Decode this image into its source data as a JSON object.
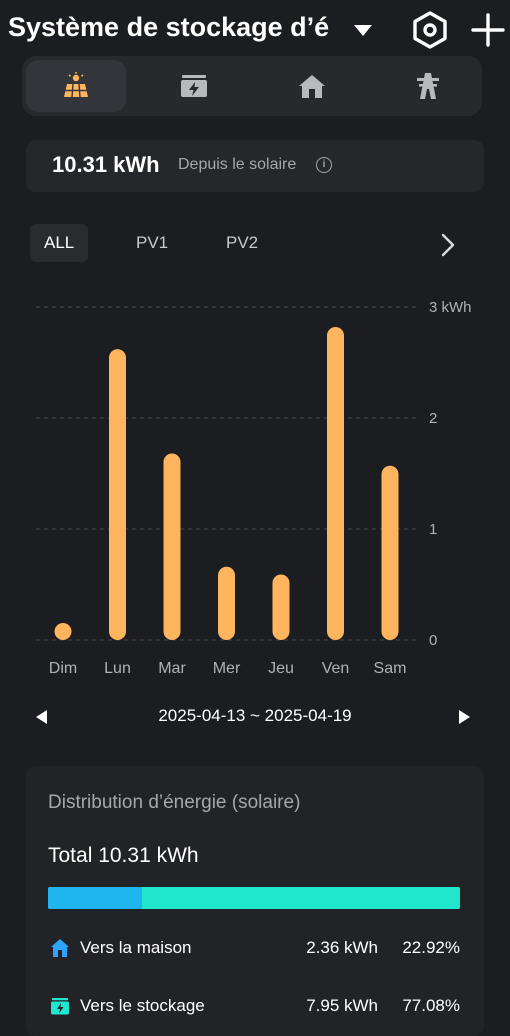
{
  "header": {
    "title": "Système de stockage d’é",
    "icons": [
      "chevron-down-icon",
      "hex-settings-icon",
      "plus-icon"
    ]
  },
  "top_tabs": [
    {
      "name": "solar",
      "icon": "solar-panel-icon",
      "active": true
    },
    {
      "name": "storage",
      "icon": "battery-icon",
      "active": false
    },
    {
      "name": "home",
      "icon": "house-icon",
      "active": false
    },
    {
      "name": "grid",
      "icon": "power-tower-icon",
      "active": false
    }
  ],
  "summary": {
    "value": "10.31 kWh",
    "label": "Depuis le solaire"
  },
  "pv_tabs": {
    "items": [
      "ALL",
      "PV1",
      "PV2"
    ],
    "selected": "ALL"
  },
  "chart_data": {
    "type": "bar",
    "categories": [
      "Dim",
      "Lun",
      "Mar",
      "Mer",
      "Jeu",
      "Ven",
      "Sam"
    ],
    "values": [
      0.12,
      2.62,
      1.68,
      0.66,
      0.59,
      2.82,
      1.57
    ],
    "ylim": [
      0,
      3
    ],
    "yticks": [
      "0",
      "1",
      "2",
      "3 kWh"
    ],
    "bar_color": "#ffb45e",
    "grid": true
  },
  "date_range": "2025-04-13 ~ 2025-04-19",
  "distribution": {
    "heading": "Distribution d’énergie (solaire)",
    "total": "Total 10.31 kWh",
    "bar": {
      "home_fraction": 0.2292,
      "storage_fraction": 0.7708
    },
    "rows": [
      {
        "label": "Vers la maison",
        "kwh": "2.36 kWh",
        "pct": "22.92%",
        "icon": "house-icon",
        "color": "#2ea3ff"
      },
      {
        "label": "Vers le stockage",
        "kwh": "7.95 kWh",
        "pct": "77.08%",
        "icon": "battery-icon",
        "color": "#1fe6cc"
      }
    ]
  },
  "colors": {
    "background": "#1c1d20",
    "bar": "#ffb45e",
    "home": "#1fb6f0",
    "storage": "#1fe6cc"
  }
}
